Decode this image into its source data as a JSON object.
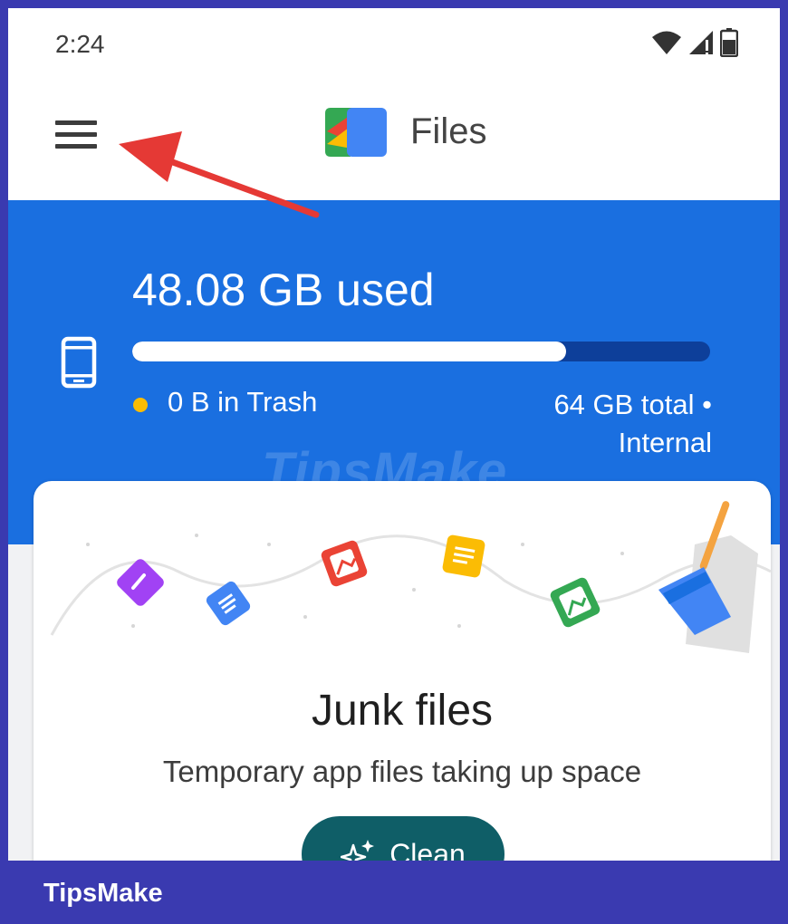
{
  "status_bar": {
    "time": "2:24",
    "icons": [
      "wifi-icon",
      "cellular-signal-icon",
      "battery-icon"
    ]
  },
  "app_bar": {
    "menu_icon": "hamburger-menu-icon",
    "logo_icon": "files-app-logo-icon",
    "title": "Files"
  },
  "storage": {
    "used_label": "48.08 GB used",
    "used_fraction": 0.75,
    "trash_label": "0 B in Trash",
    "total_line1": "64 GB total •",
    "total_line2": "Internal",
    "device_icon": "phone-icon"
  },
  "junk_card": {
    "title": "Junk files",
    "subtitle": "Temporary app files taking up space",
    "button_label": "Clean",
    "button_icon": "sparkle-icon"
  },
  "watermark": "TipsMake",
  "brand": "TipsMake",
  "colors": {
    "primary_blue": "#1a6fe0",
    "bar_track": "#0d3f9a",
    "trash_dot": "#fbbc04",
    "button_teal": "#0f5e67",
    "frame_border": "#3a3ab0",
    "arrow_red": "#e53935"
  }
}
